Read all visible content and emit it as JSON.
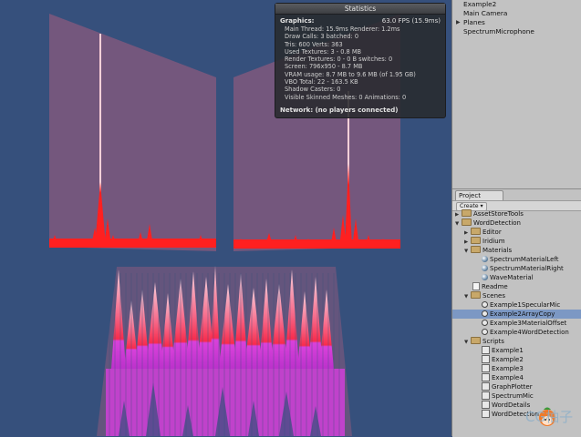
{
  "statistics": {
    "title": "Statistics",
    "graphics_label": "Graphics:",
    "fps": "63.0 FPS (15.9ms)",
    "lines": [
      "Main Thread: 15.9ms  Renderer: 1.2ms",
      "Draw Calls: 3  batched: 0",
      "Tris: 600  Verts: 363",
      "Used Textures: 3 - 0.8 MB",
      "Render Textures: 0 - 0 B  switches: 0",
      "Screen: 796x950 - 8.7 MB",
      "VRAM usage: 8.7 MB to 9.6 MB (of 1.95 GB)",
      "VBO Total: 22 - 163.5 KB",
      "Shadow Casters: 0",
      "Visible Skinned Meshes: 0     Animations: 0"
    ],
    "network": "Network: (no players connected)"
  },
  "hierarchy": {
    "items": [
      "Example2",
      "Main Camera",
      "Planes",
      "SpectrumMicrophone"
    ]
  },
  "project": {
    "tab_label": "Project",
    "create_label": "Create ▾",
    "tree": [
      {
        "label": "AssetStoreTools",
        "icon": "folder-icon"
      },
      {
        "label": "WordDetection",
        "icon": "folder-icon"
      },
      {
        "label": "Editor",
        "icon": "folder-icon"
      },
      {
        "label": "Iridium",
        "icon": "folder-icon"
      },
      {
        "label": "Materials",
        "icon": "folder-icon"
      },
      {
        "label": "SpectrumMaterialLeft",
        "icon": "material-icon"
      },
      {
        "label": "SpectrumMaterialRight",
        "icon": "material-icon"
      },
      {
        "label": "WaveMaterial",
        "icon": "material-icon"
      },
      {
        "label": "Readme",
        "icon": "document-icon"
      },
      {
        "label": "Scenes",
        "icon": "folder-icon"
      },
      {
        "label": "Example1SpecularMic",
        "icon": "unity-scene-icon"
      },
      {
        "label": "Example2ArrayCopy",
        "icon": "unity-scene-icon"
      },
      {
        "label": "Example3MaterialOffset",
        "icon": "unity-scene-icon"
      },
      {
        "label": "Example4WordDetection",
        "icon": "unity-scene-icon"
      },
      {
        "label": "Scripts",
        "icon": "folder-icon"
      },
      {
        "label": "Example1",
        "icon": "script-icon"
      },
      {
        "label": "Example2",
        "icon": "script-icon"
      },
      {
        "label": "Example3",
        "icon": "script-icon"
      },
      {
        "label": "Example4",
        "icon": "script-icon"
      },
      {
        "label": "GraphPlotter",
        "icon": "script-icon"
      },
      {
        "label": "SpectrumMic",
        "icon": "script-icon"
      },
      {
        "label": "WordDetails",
        "icon": "script-icon"
      },
      {
        "label": "WordDetection",
        "icon": "script-icon"
      }
    ]
  },
  "watermark": "CG柚子",
  "colors": {
    "background": "#36507c",
    "panel_fill": "#8a5a7e",
    "spectrum_red": "#ff1a1a",
    "wave_pink": "#ffb8c8",
    "wave_magenta": "#e040e0",
    "selection": "#7c98c4"
  }
}
